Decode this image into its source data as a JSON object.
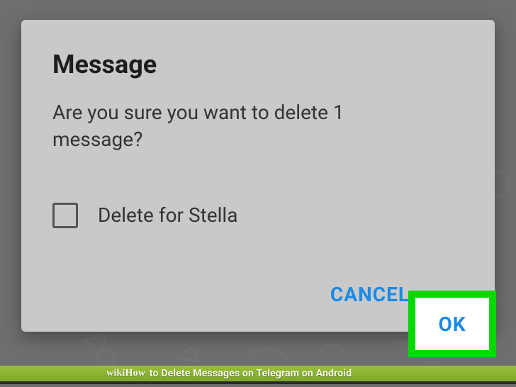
{
  "dialog": {
    "title": "Message",
    "body": "Are you sure you want to delete 1 message?",
    "checkbox_label": "Delete for Stella",
    "cancel_label": "CANCEL",
    "ok_label": "OK"
  },
  "footer": {
    "brand_prefix": "wiki",
    "brand_suffix": "How",
    "article_title": "to Delete Messages on Telegram on Android"
  }
}
